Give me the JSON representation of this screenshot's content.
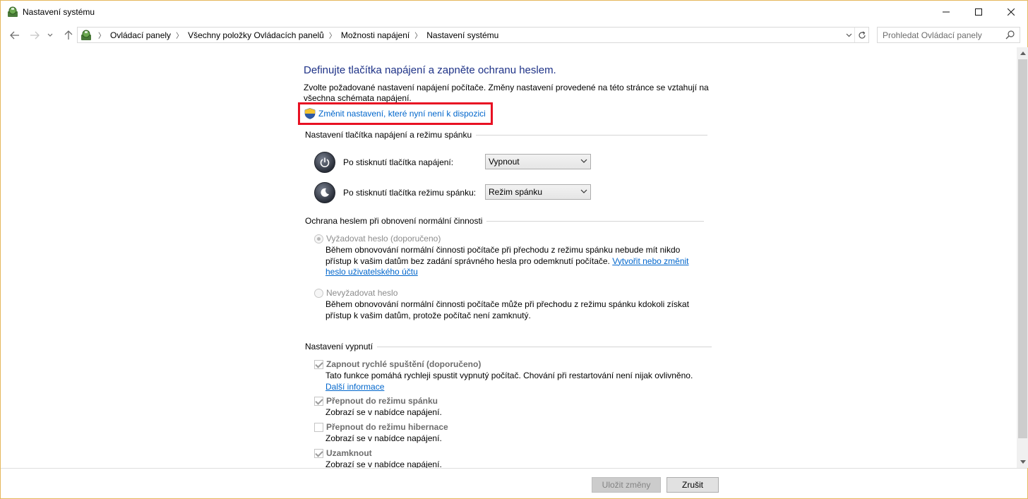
{
  "window": {
    "title": "Nastavení systému"
  },
  "address_bar": {
    "breadcrumbs": [
      "Ovládací panely",
      "Všechny položky Ovládacích panelů",
      "Možnosti napájení",
      "Nastavení systému"
    ]
  },
  "search": {
    "placeholder": "Prohledat Ovládací panely"
  },
  "main": {
    "heading": "Definujte tlačítka napájení a zapněte ochranu heslem.",
    "intro": "Zvolte požadované nastavení napájení počítače. Změny nastavení provedené na této stránce se vztahují na všechna schémata napájení.",
    "change_link": "Změnit nastavení, které nyní není k dispozici",
    "power_section": {
      "title": "Nastavení tlačítka napájení a režimu spánku",
      "power_button_label": "Po stisknutí tlačítka napájení:",
      "power_button_value": "Vypnout",
      "sleep_button_label": "Po stisknutí tlačítka režimu spánku:",
      "sleep_button_value": "Režim spánku"
    },
    "password_section": {
      "title": "Ochrana heslem při obnovení normální činnosti",
      "require_label": "Vyžadovat heslo (doporučeno)",
      "require_desc": "Během obnovování normální činnosti počítače při přechodu z režimu spánku nebude mít nikdo přístup k vašim datům bez zadání správného hesla pro odemknutí počítače.",
      "require_link": "Vytvořit nebo změnit heslo uživatelského účtu",
      "no_require_label": "Nevyžadovat heslo",
      "no_require_desc": "Během obnovování normální činnosti počítače může při přechodu z režimu spánku kdokoli získat přístup k vašim datům, protože počítač není zamknutý."
    },
    "shutdown_section": {
      "title": "Nastavení vypnutí",
      "fast_startup_label": "Zapnout rychlé spuštění (doporučeno)",
      "fast_startup_desc": "Tato funkce pomáhá rychleji spustit vypnutý počítač. Chování při restartování není nijak ovlivněno.",
      "fast_startup_link": "Další informace",
      "sleep_label": "Přepnout do režimu spánku",
      "sleep_desc": "Zobrazí se v nabídce napájení.",
      "hibernate_label": "Přepnout do režimu hibernace",
      "hibernate_desc": "Zobrazí se v nabídce napájení.",
      "lock_label": "Uzamknout",
      "lock_desc": "Zobrazí se v nabídce napájení."
    }
  },
  "footer": {
    "save_label": "Uložit změny",
    "cancel_label": "Zrušit"
  }
}
